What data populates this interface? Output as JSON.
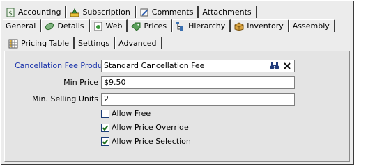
{
  "tabs_row1": [
    {
      "label": "Accounting",
      "icon": "accounting-icon"
    },
    {
      "label": "Subscription",
      "icon": "subscription-icon"
    },
    {
      "label": "Comments",
      "icon": "comments-icon"
    },
    {
      "label": "Attachments",
      "icon": ""
    }
  ],
  "tabs_row2": [
    {
      "label": "General",
      "icon": ""
    },
    {
      "label": "Details",
      "icon": "details-icon"
    },
    {
      "label": "Web",
      "icon": "web-icon"
    },
    {
      "label": "Prices",
      "icon": "prices-icon"
    },
    {
      "label": "Hierarchy",
      "icon": "hierarchy-icon"
    },
    {
      "label": "Inventory",
      "icon": "inventory-icon"
    },
    {
      "label": "Assembly",
      "icon": ""
    }
  ],
  "tabs_row3": [
    {
      "label": "Pricing Table",
      "icon": "pricing-table-icon"
    },
    {
      "label": "Settings",
      "icon": ""
    },
    {
      "label": "Advanced",
      "icon": ""
    }
  ],
  "active": {
    "row2": "Prices",
    "row3": "Settings"
  },
  "form": {
    "cancellation_fee_product": {
      "label": "Cancellation Fee Product",
      "value": "Standard Cancellation Fee"
    },
    "min_price": {
      "label": "Min Price",
      "value": "$9.50"
    },
    "min_selling_units": {
      "label": "Min. Selling Units",
      "value": "2"
    }
  },
  "checkboxes": [
    {
      "label": "Allow Free",
      "checked": false
    },
    {
      "label": "Allow Price Override",
      "checked": true
    },
    {
      "label": "Allow Price Selection",
      "checked": true
    }
  ],
  "colors": {
    "link": "#1a33aa",
    "check_border": "#1c3e78",
    "check_mark": "#1b6e1b"
  }
}
